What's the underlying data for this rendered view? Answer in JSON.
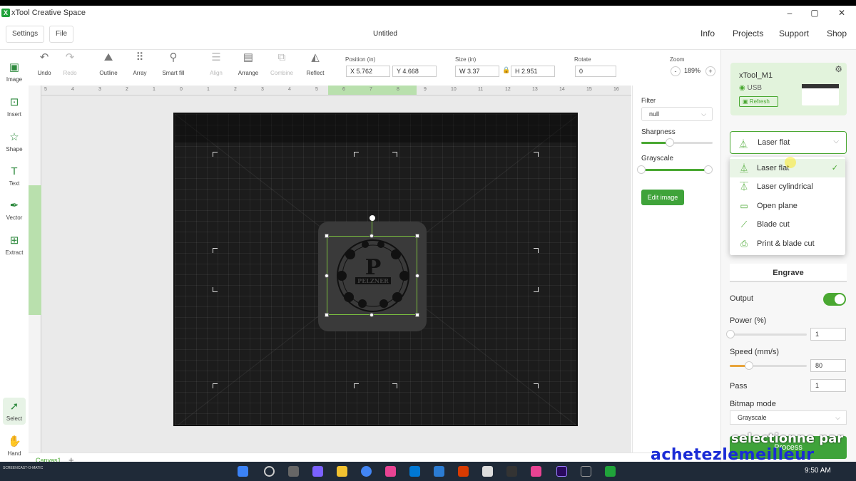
{
  "titlebar": {
    "app_title": "xTool Creative Space",
    "logo": "X"
  },
  "topnav": {
    "settings": "Settings",
    "file": "File",
    "doc_title": "Untitled",
    "links": [
      "Info",
      "Projects",
      "Support",
      "Shop"
    ]
  },
  "toolbar": {
    "undo": "Undo",
    "redo": "Redo",
    "outline": "Outline",
    "array": "Array",
    "smart_fill": "Smart fill",
    "align": "Align",
    "arrange": "Arrange",
    "combine": "Combine",
    "reflect": "Reflect",
    "position_label": "Position (in)",
    "pos_x": "X 5.762",
    "pos_y": "Y 4.668",
    "size_label": "Size (in)",
    "size_w": "W 3.37",
    "size_h": "H 2.951",
    "rotate_label": "Rotate",
    "rotate_value": "0",
    "zoom_label": "Zoom",
    "zoom_value": "189%",
    "zoom_minus": "-",
    "zoom_plus": "+"
  },
  "left_tools": [
    "Image",
    "Insert",
    "Shape",
    "Text",
    "Vector",
    "Extract",
    "Select",
    "Hand"
  ],
  "ruler_ticks": [
    "5",
    "4",
    "3",
    "2",
    "1",
    "0",
    "1",
    "2",
    "3",
    "4",
    "5",
    "6",
    "7",
    "8",
    "9",
    "10",
    "11",
    "12",
    "13",
    "14",
    "15",
    "16"
  ],
  "design_text": {
    "letter": "P",
    "name": "PELZNER"
  },
  "image_panel": {
    "filter_label": "Filter",
    "filter_value": "null",
    "sharpness_label": "Sharpness",
    "sharpness_level": 0.4,
    "grayscale_label": "Grayscale",
    "edit_image": "Edit image"
  },
  "machine": {
    "name": "xTool_M1",
    "connection": "USB",
    "refresh": "Refresh"
  },
  "mode": {
    "selected": "Laser flat",
    "options": [
      "Laser flat",
      "Laser cylindrical",
      "Open plane",
      "Blade cut",
      "Print & blade cut"
    ],
    "checkmark": "✓"
  },
  "process": {
    "engrave_tab": "Engrave",
    "output_label": "Output",
    "output_on": true,
    "power_label": "Power (%)",
    "power_value": "1",
    "power_level": 0.01,
    "speed_label": "Speed (mm/s)",
    "speed_value": "80",
    "speed_level": 0.25,
    "pass_label": "Pass",
    "pass_value": "1",
    "bitmap_label": "Bitmap mode",
    "bitmap_value": "Grayscale",
    "process_button": "Process"
  },
  "canvas_tab": {
    "name": "Canvas1",
    "add": "+"
  },
  "taskbar": {
    "time": "9:50 AM",
    "recorder": "SCREENCAST-O-MATIC"
  },
  "watermarks": {
    "line1": "selectionne par",
    "line2": "achetezlemeilleur"
  },
  "colors": {
    "accent": "#4aa832",
    "selection": "#7bbf3f",
    "canvas_bg": "#1c1c1c",
    "watermark_blue": "#1a2bd6"
  }
}
